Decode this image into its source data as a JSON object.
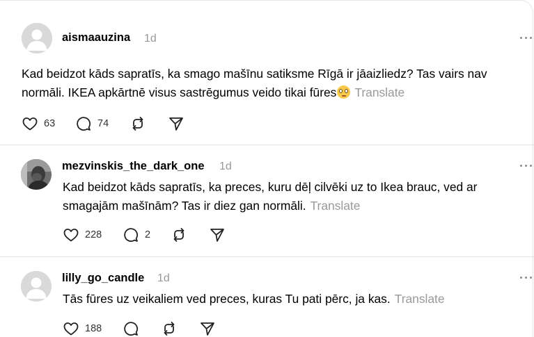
{
  "posts": [
    {
      "username": "aismaauzina",
      "time": "1d",
      "text": "Kad beidzot kāds sapratīs, ka smago mašīnu satiksme Rīgā ir jāaizliedz? Tas vairs nav normāli. IKEA apkārtnē visus sastrēgumus veido tikai fūres",
      "emoji": "face-with-rolling-eyes",
      "translate": "Translate",
      "likes": "63",
      "replies": "74",
      "avatar": "default-avatar"
    },
    {
      "username": "mezvinskis_the_dark_one",
      "time": "1d",
      "text": "Kad beidzot kāds sapratīs, ka preces, kuru dēļ cilvēki uz to Ikea brauc, ved ar smagajām mašīnām? Tas ir diez gan normāli.",
      "translate": "Translate",
      "likes": "228",
      "replies": "2",
      "avatar": "photo-avatar"
    },
    {
      "username": "lilly_go_candle",
      "time": "1d",
      "text": "Tās fūres uz veikaliem ved preces, kuras Tu pati pērc, ja kas.",
      "translate": "Translate",
      "likes": "188",
      "replies": "",
      "avatar": "default-avatar"
    }
  ],
  "colors": {
    "muted": "#999999",
    "divider": "#e3e3e3",
    "avatar_bg": "#d9d9d9"
  }
}
